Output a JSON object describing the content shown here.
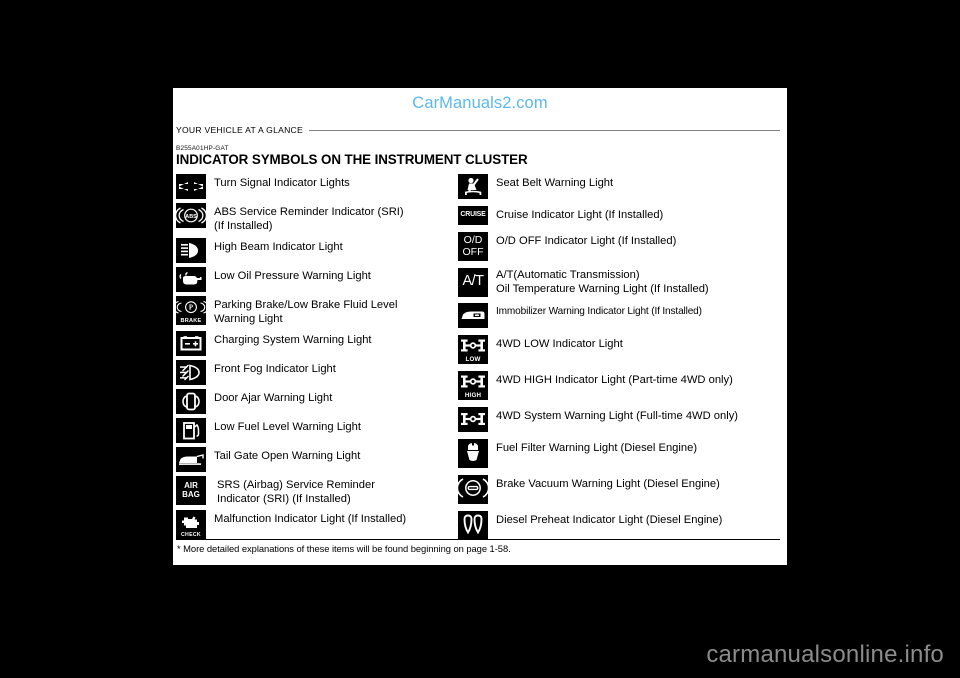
{
  "brand": {
    "logo_text": "CarManuals2.com",
    "logo_color": "#5bb8f0"
  },
  "header": {
    "section_label": "YOUR VEHICLE AT A GLANCE",
    "doc_code": "B255A01HP-GAT",
    "title": "INDICATOR SYMBOLS ON THE INSTRUMENT CLUSTER"
  },
  "left_column": [
    {
      "icon": "turn-signal-icon",
      "label": "Turn Signal Indicator Lights"
    },
    {
      "icon": "abs-icon",
      "label": "ABS Service Reminder Indicator (SRI)\n(If Installed)"
    },
    {
      "icon": "high-beam-icon",
      "label": "High Beam Indicator Light"
    },
    {
      "icon": "low-oil-pressure-icon",
      "label": "Low Oil Pressure Warning Light"
    },
    {
      "icon": "parking-brake-icon",
      "icon_text": "BRAKE",
      "label": "Parking Brake/Low Brake Fluid Level\nWarning Light"
    },
    {
      "icon": "charging-system-icon",
      "label": "Charging System Warning Light"
    },
    {
      "icon": "front-fog-icon",
      "label": "Front Fog Indicator Light"
    },
    {
      "icon": "door-ajar-icon",
      "label": "Door Ajar Warning Light"
    },
    {
      "icon": "low-fuel-icon",
      "label": "Low Fuel Level Warning Light"
    },
    {
      "icon": "tail-gate-open-icon",
      "label": "Tail Gate Open Warning Light"
    },
    {
      "icon": "airbag-icon",
      "icon_text": "AIR\nBAG",
      "label": "SRS (Airbag) Service Reminder\nIndicator (SRI) (If Installed)"
    },
    {
      "icon": "malfunction-indicator-icon",
      "icon_text": "CHECK",
      "label": "Malfunction Indicator Light  (If Installed)"
    }
  ],
  "right_column": [
    {
      "icon": "seat-belt-icon",
      "label": "Seat Belt Warning Light"
    },
    {
      "icon": "cruise-icon",
      "icon_text": "CRUISE",
      "label": "Cruise Indicator Light (If Installed)"
    },
    {
      "icon": "od-off-icon",
      "icon_text": "O/D\nOFF",
      "label": "O/D OFF Indicator Light (If Installed)"
    },
    {
      "icon": "at-icon",
      "icon_text": "A/T",
      "label": "A/T(Automatic Transmission)\nOil Temperature Warning Light (If Installed)"
    },
    {
      "icon": "immobilizer-icon",
      "label": "Immobilizer Warning Indicator Light (If Installed)"
    },
    {
      "icon": "4wd-low-icon",
      "icon_text": "LOW",
      "label": "4WD LOW Indicator Light"
    },
    {
      "icon": "4wd-high-icon",
      "icon_text": "HIGH",
      "label": "4WD HIGH Indicator Light (Part-time 4WD only)"
    },
    {
      "icon": "4wd-system-icon",
      "label": "4WD  System Warning Light (Full-time 4WD only)"
    },
    {
      "icon": "fuel-filter-icon",
      "label": "Fuel Filter Warning Light (Diesel Engine)"
    },
    {
      "icon": "brake-vacuum-icon",
      "label": "Brake Vacuum Warning Light (Diesel Engine)"
    },
    {
      "icon": "diesel-preheat-icon",
      "label": "Diesel Preheat Indicator Light (Diesel Engine)"
    }
  ],
  "footnote": "* More detailed explanations of these items will be found beginning on page 1-58.",
  "watermark": {
    "text": "carmanualsonline.info",
    "color": "#8c8c8c"
  }
}
